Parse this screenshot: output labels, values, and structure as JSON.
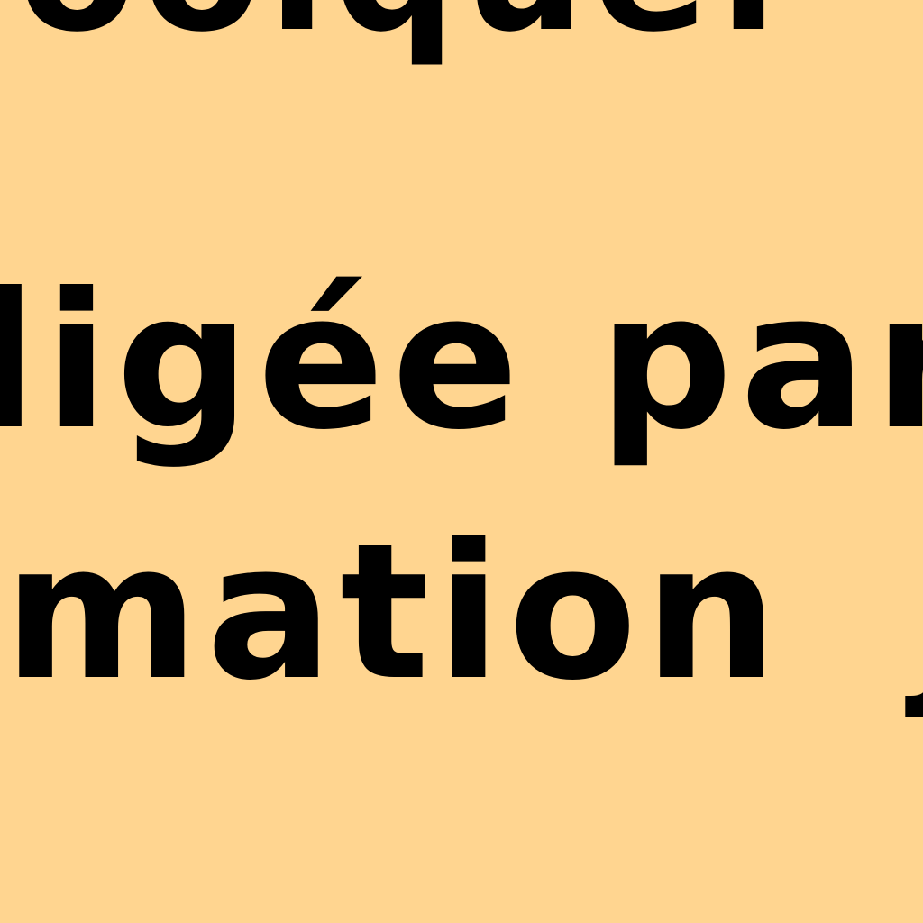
{
  "zoomed_document": {
    "lines": [
      {
        "text": "ooique."
      },
      {
        "text": "ligée par"
      },
      {
        "text": "mation j"
      }
    ]
  },
  "colors": {
    "background": "#ffd590",
    "text": "#000000"
  }
}
